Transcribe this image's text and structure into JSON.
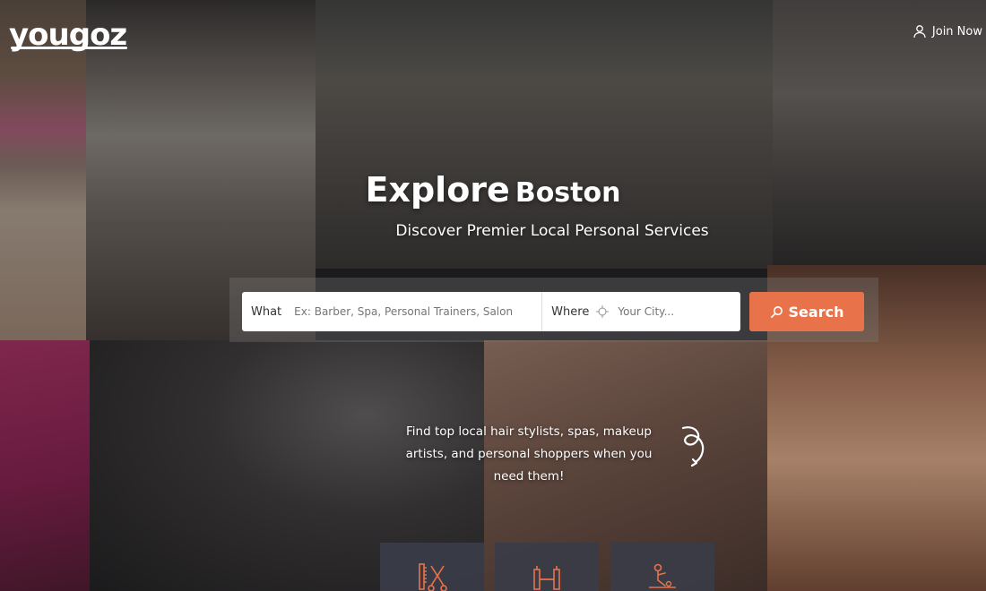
{
  "brand": {
    "logo_text": "yougoz",
    "accent_color": "#e8734a"
  },
  "header": {
    "join_label": "Join Now",
    "join_icon": "user-icon"
  },
  "hero": {
    "title": "Explore",
    "city": "Boston",
    "subtitle": "Discover Premier Local Personal Services"
  },
  "search": {
    "what_label": "What",
    "what_placeholder": "Ex: Barber, Spa, Personal Trainers, Salon",
    "where_label": "Where",
    "where_icon": "crosshair-icon",
    "where_placeholder": "Your City...",
    "button_label": "Search",
    "button_icon": "search-icon"
  },
  "promo": {
    "text": "Find top local hair stylists, spas, makeup artists, and personal shoppers when you need them!"
  },
  "categories": [
    {
      "icon": "comb-scissors-icon"
    },
    {
      "icon": "dumbbell-icon"
    },
    {
      "icon": "massage-icon"
    }
  ]
}
